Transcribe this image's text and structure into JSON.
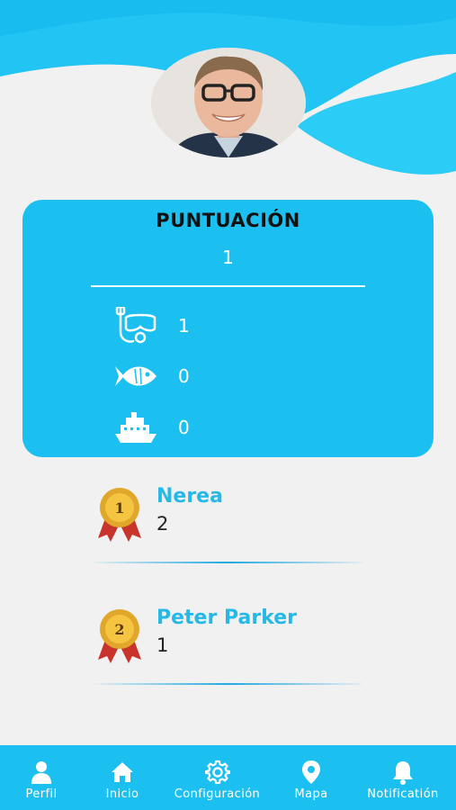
{
  "colors": {
    "primary": "#1cc0f0",
    "accent_text": "#27b9e6",
    "background": "#f1f1f1"
  },
  "profile": {
    "avatar_icon": "user-photo"
  },
  "score": {
    "title": "PUNTUACIÓN",
    "total": "1",
    "stats": [
      {
        "icon": "snorkel-mask-icon",
        "value": "1"
      },
      {
        "icon": "fish-icon",
        "value": "0"
      },
      {
        "icon": "ship-icon",
        "value": "0"
      }
    ]
  },
  "ranking": [
    {
      "position": "1",
      "name": "Nerea",
      "points": "2"
    },
    {
      "position": "2",
      "name": "Peter Parker",
      "points": "1"
    }
  ],
  "nav": [
    {
      "label": "Perfil",
      "icon": "person-icon"
    },
    {
      "label": "Inicio",
      "icon": "home-icon"
    },
    {
      "label": "Configuración",
      "icon": "gear-icon"
    },
    {
      "label": "Mapa",
      "icon": "map-pin-icon"
    },
    {
      "label": "Notificatión",
      "icon": "bell-icon"
    }
  ]
}
